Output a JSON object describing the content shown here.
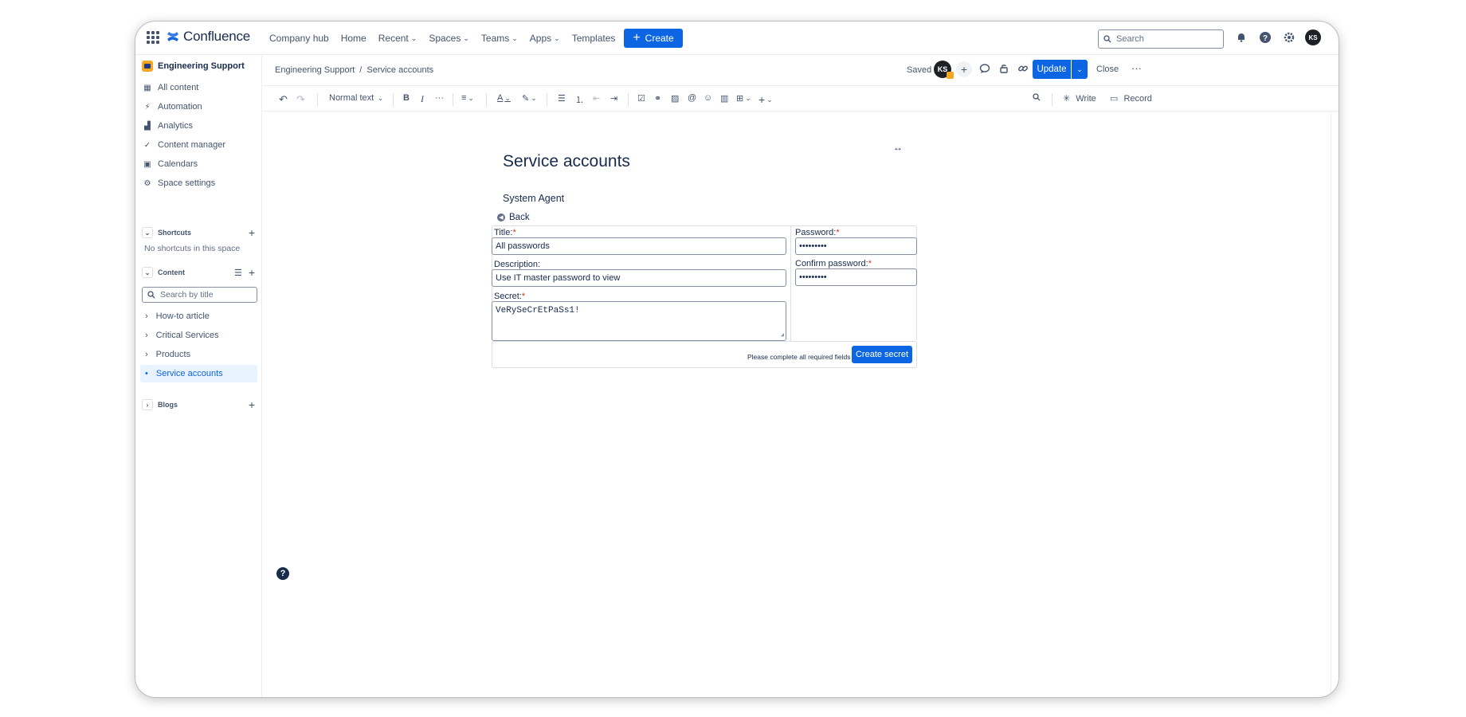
{
  "app": {
    "name": "Confluence"
  },
  "topnav": {
    "items": [
      {
        "label": "Company hub",
        "dropdown": false
      },
      {
        "label": "Home",
        "dropdown": false
      },
      {
        "label": "Recent",
        "dropdown": true
      },
      {
        "label": "Spaces",
        "dropdown": true
      },
      {
        "label": "Teams",
        "dropdown": true
      },
      {
        "label": "Apps",
        "dropdown": true
      },
      {
        "label": "Templates",
        "dropdown": false
      }
    ],
    "create_label": "Create",
    "search_placeholder": "Search",
    "user_initials": "KS"
  },
  "sidebar": {
    "space_title": "Engineering Support",
    "links": [
      {
        "label": "All content",
        "icon": "grid-icon"
      },
      {
        "label": "Automation",
        "icon": "bolt-icon"
      },
      {
        "label": "Analytics",
        "icon": "bar-chart-icon"
      },
      {
        "label": "Content manager",
        "icon": "content-manager-icon"
      },
      {
        "label": "Calendars",
        "icon": "calendar-icon"
      },
      {
        "label": "Space settings",
        "icon": "gear-icon"
      }
    ],
    "shortcuts_label": "Shortcuts",
    "no_shortcuts": "No shortcuts in this space",
    "content_label": "Content",
    "search_placeholder": "Search by title",
    "tree": [
      {
        "label": "How-to article",
        "active": false
      },
      {
        "label": "Critical Services",
        "active": false
      },
      {
        "label": "Products",
        "active": false
      },
      {
        "label": "Service accounts",
        "active": true
      }
    ],
    "blogs_label": "Blogs"
  },
  "header": {
    "breadcrumb": [
      "Engineering Support",
      "Service accounts"
    ],
    "saved_label": "Saved",
    "avatar_initials": "KS",
    "update_label": "Update",
    "close_label": "Close"
  },
  "toolbar": {
    "text_style": "Normal text",
    "write_label": "Write",
    "record_label": "Record"
  },
  "page": {
    "title": "Service accounts",
    "agent_label": "System Agent",
    "back_label": "Back",
    "form": {
      "title_label": "Title:",
      "title_value": "All passwords",
      "description_label": "Description:",
      "description_value": "Use IT master password to view",
      "secret_label": "Secret:",
      "secret_value": "VeRySeCrEtPaSs1!",
      "password_label": "Password:",
      "password_value": "•••••••••",
      "confirm_label": "Confirm password:",
      "confirm_value": "•••••••••",
      "required_mark": "*",
      "submit_note": "Please complete all required fields",
      "submit_label": "Create secret"
    }
  },
  "colors": {
    "accent": "#0c66e4",
    "required": "#ca3521",
    "text": "#172b4d",
    "muted": "#44546f"
  }
}
